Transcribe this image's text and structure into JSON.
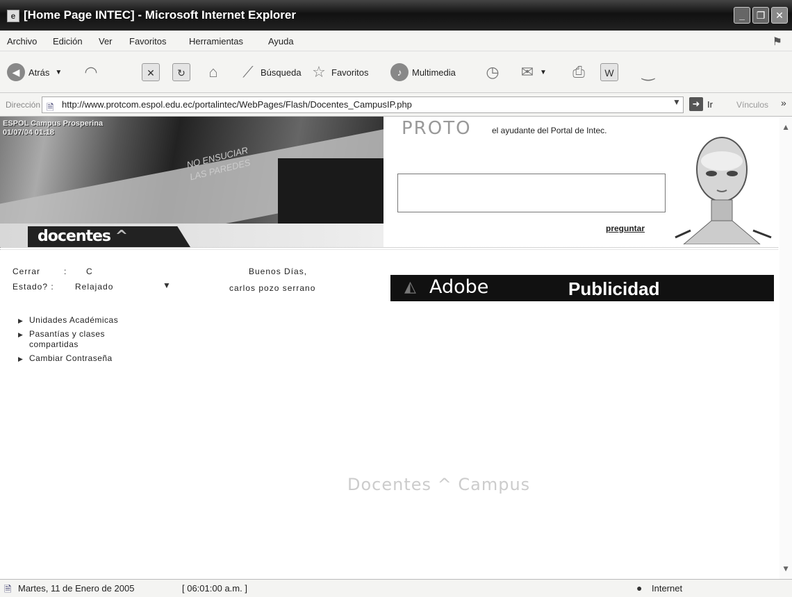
{
  "window": {
    "title": "[Home Page INTEC] - Microsoft Internet Explorer",
    "app_icon": "ie-page-icon",
    "controls": [
      "minimize",
      "maximize",
      "close"
    ]
  },
  "menu": {
    "items": [
      "Archivo",
      "Edición",
      "Ver",
      "Favoritos",
      "Herramientas",
      "Ayuda"
    ]
  },
  "toolbar": {
    "back_label": "Atrás",
    "search_label": "Búsqueda",
    "favorites_label": "Favoritos",
    "media_label": "Multimedia"
  },
  "address": {
    "label": "Dirección",
    "url": "http://www.protcom.espol.edu.ec/portalintec/WebPages/Flash/Docentes_CampusIP.php",
    "go_label": "Ir",
    "links_label": "Vínculos",
    "links_more": "»"
  },
  "page": {
    "banner_stamp": "ESPOL Campus Prosperina\n01/07/04 01:18",
    "banner_graffiti": "NO ENSUCIAR\nLAS PAREDES",
    "logo_left": "docentes",
    "logo_sep": "^",
    "logo_right": "campus",
    "assistant": {
      "logo": "PROTO",
      "message": "el ayudante del Portal de Intec.",
      "ask_button": "preguntar"
    },
    "ad": {
      "logo": "Adobe",
      "title": "Publicidad"
    },
    "controls": {
      "close_label": "Cerrar",
      "close_sep": ":",
      "close_value": "C",
      "state_label": "Estado? :",
      "state_value": "Relajado",
      "greeting": "Buenos Días,",
      "user_name": "carlos pozo serrano"
    },
    "nav": [
      "Unidades Académicas",
      "Pasantías y clases compartidas",
      "Cambiar Contraseña"
    ],
    "watermark": "Docentes ^ Campus"
  },
  "statusbar": {
    "date": "Martes, 11 de Enero de 2005",
    "time": "[ 06:01:00 a.m. ]",
    "zone": "Internet"
  }
}
